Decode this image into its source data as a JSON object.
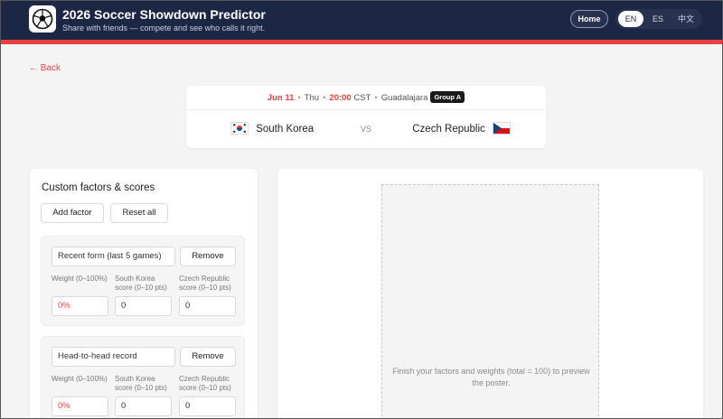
{
  "app": {
    "title": "2026 Soccer Showdown Predictor",
    "subtitle": "Share with friends — compete and see who calls it right.",
    "logo_icon": "soccer-ball-icon"
  },
  "nav": {
    "home_label": "Home",
    "languages": [
      "EN",
      "ES",
      "中文"
    ],
    "active_language": "EN"
  },
  "back_label": "← Back",
  "match": {
    "date": "Jun 11",
    "day": "Thu",
    "time": "20:00",
    "timezone": "CST",
    "city": "Guadalajara",
    "group": "Group A",
    "home_team": "South Korea",
    "home_flag_icon": "south-korea-flag-icon",
    "away_team": "Czech Republic",
    "away_flag_icon": "czech-republic-flag-icon",
    "vs_label": "VS"
  },
  "factors_panel": {
    "title": "Custom factors & scores",
    "add_label": "Add factor",
    "reset_label": "Reset all",
    "remove_label": "Remove",
    "weight_label": "Weight (0–100%)",
    "home_score_label": "South Korea score (0–10 pts)",
    "away_score_label": "Czech Republic score (0–10 pts)",
    "factors": [
      {
        "name": "Recent form (last 5 games)",
        "weight": "0%",
        "home_score": "0",
        "away_score": "0"
      },
      {
        "name": "Head-to-head record",
        "weight": "0%",
        "home_score": "0",
        "away_score": "0"
      }
    ]
  },
  "poster": {
    "message": "Finish your factors and weights (total = 100) to preview the poster."
  },
  "colors": {
    "header_bg": "#1c2745",
    "accent_red": "#e54343",
    "page_bg": "#f4f4f5"
  }
}
